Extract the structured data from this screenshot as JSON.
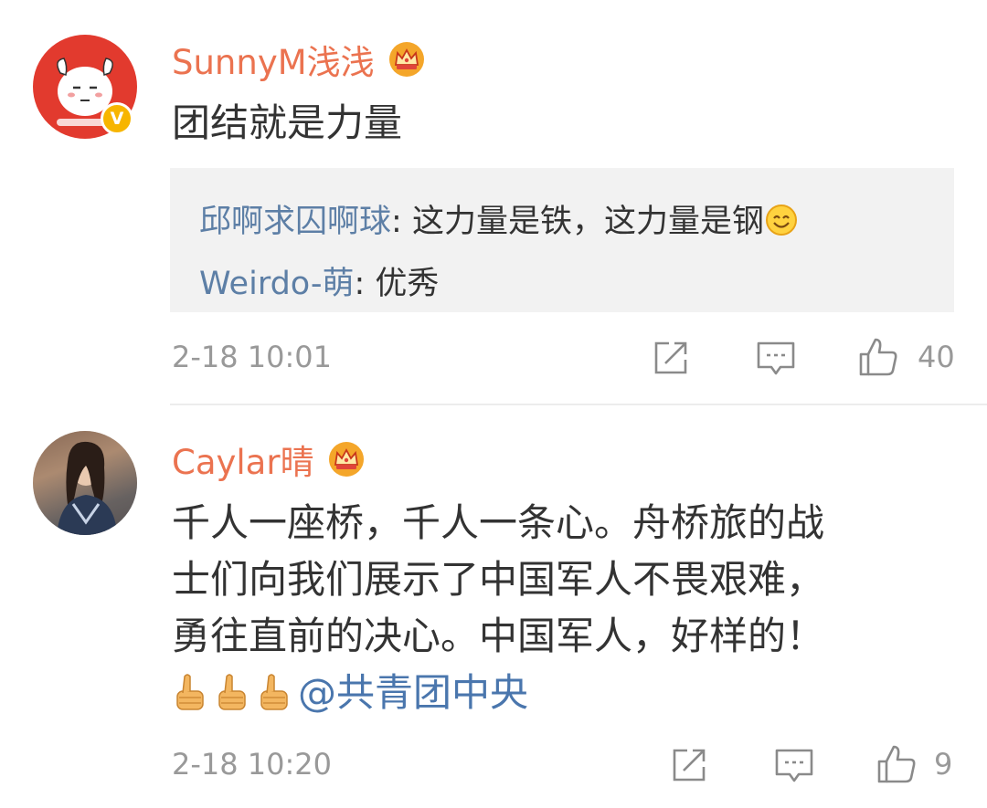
{
  "comments": [
    {
      "username": "SunnyM浅浅",
      "avatar_icon": "cartoon-girl-avatar",
      "verified_badge": "V",
      "vip_icon": "crown-icon",
      "text": "团结就是力量",
      "replies": [
        {
          "user": "邱啊求囚啊球",
          "separator": ": ",
          "text": "这力量是铁，这力量是钢",
          "emoji": "smile-emoji"
        },
        {
          "user": "Weirdo-萌",
          "separator": ": ",
          "text": "优秀"
        }
      ],
      "timestamp": "2-18 10:01",
      "likes": "40"
    },
    {
      "username": "Caylar晴",
      "avatar_icon": "photo-avatar",
      "vip_icon": "crown-icon",
      "text_lines": [
        "千人一座桥，千人一条心。舟桥旅的战",
        "士们向我们展示了中国军人不畏艰难，",
        "勇往直前的决心。中国军人，好样的！"
      ],
      "mention": "@共青团中央",
      "emoji": "thumbs-up-emoji",
      "timestamp": "2-18 10:20",
      "likes": "9"
    }
  ],
  "colors": {
    "username": "#eb7350",
    "reply_user": "#5d7fa6",
    "mention": "#4a76ad",
    "meta_gray": "#999999",
    "reply_bg": "#f2f2f2"
  }
}
